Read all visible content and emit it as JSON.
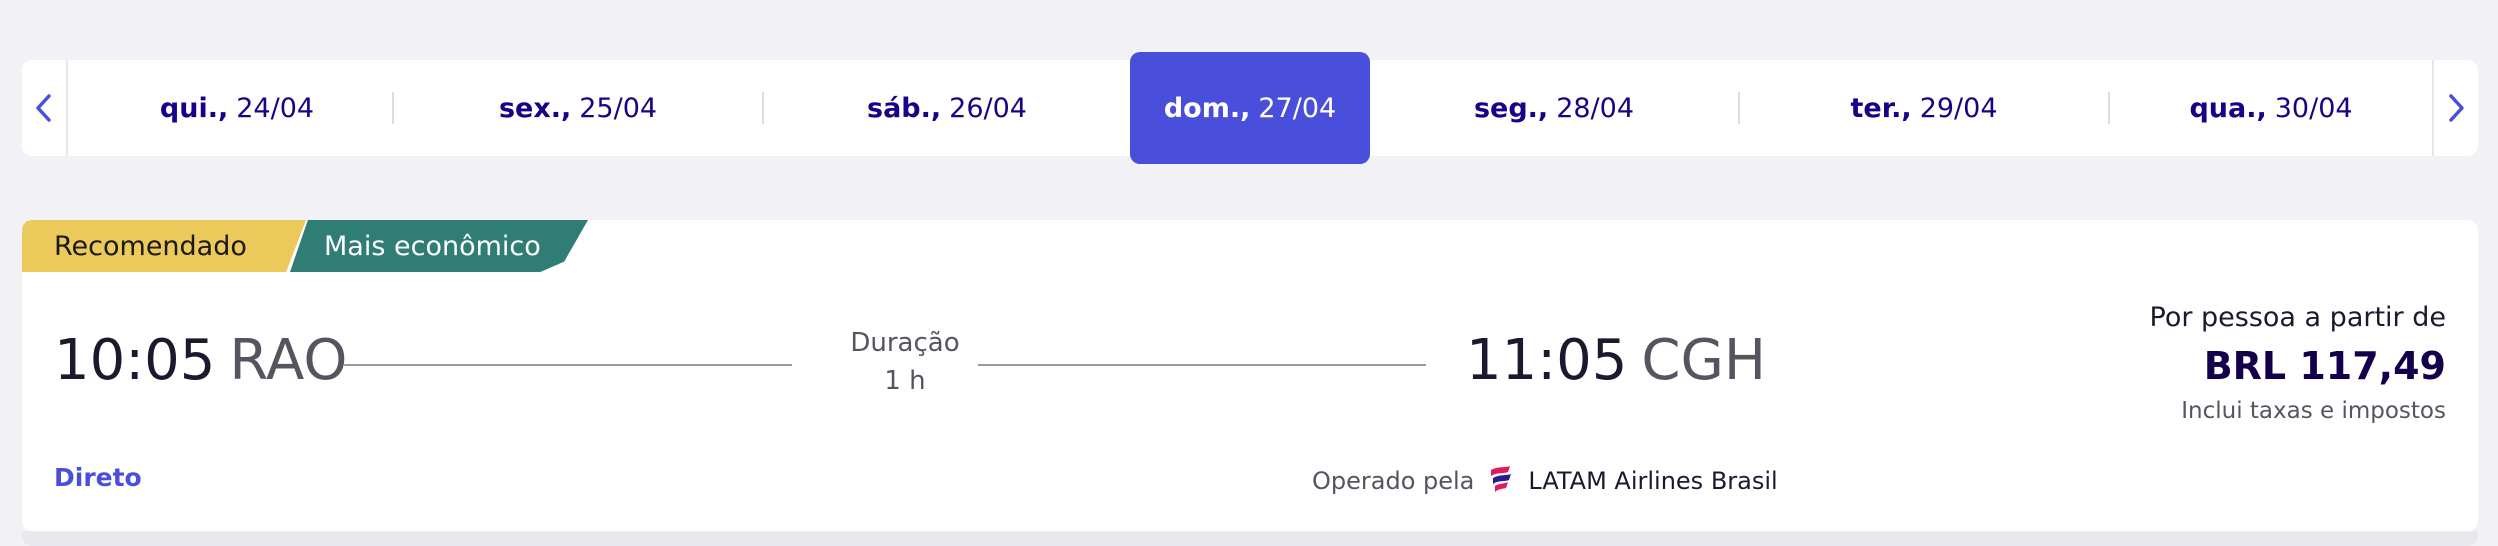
{
  "dates": [
    {
      "weekday": "qui.,",
      "date": "24/04"
    },
    {
      "weekday": "sex.,",
      "date": "25/04"
    },
    {
      "weekday": "sáb.,",
      "date": "26/04"
    },
    {
      "weekday": "dom.,",
      "date": "27/04",
      "selected": true
    },
    {
      "weekday": "seg.,",
      "date": "28/04"
    },
    {
      "weekday": "ter.,",
      "date": "29/04"
    },
    {
      "weekday": "qua.,",
      "date": "30/04"
    }
  ],
  "icons": {
    "prev": "chevron-left-icon",
    "next": "chevron-right-icon",
    "airline": "latam-logo-icon"
  },
  "colors": {
    "accent": "#4a4fdb",
    "brand_text": "#1b0088",
    "badge_recommended": "#ebc95a",
    "badge_economic": "#2f7d74"
  },
  "flight": {
    "badges": {
      "recommended": "Recomendado",
      "economic": "Mais econômico"
    },
    "departure": {
      "time": "10:05",
      "airport": "RAO"
    },
    "arrival": {
      "time": "11:05",
      "airport": "CGH"
    },
    "duration": {
      "label": "Duração",
      "value": "1 h"
    },
    "price": {
      "label": "Por pessoa a partir de",
      "amount": "BRL 117,49",
      "note": "Inclui taxas e impostos"
    },
    "stops": "Direto",
    "operated_by_label": "Operado pela",
    "airline": "LATAM Airlines Brasil"
  }
}
